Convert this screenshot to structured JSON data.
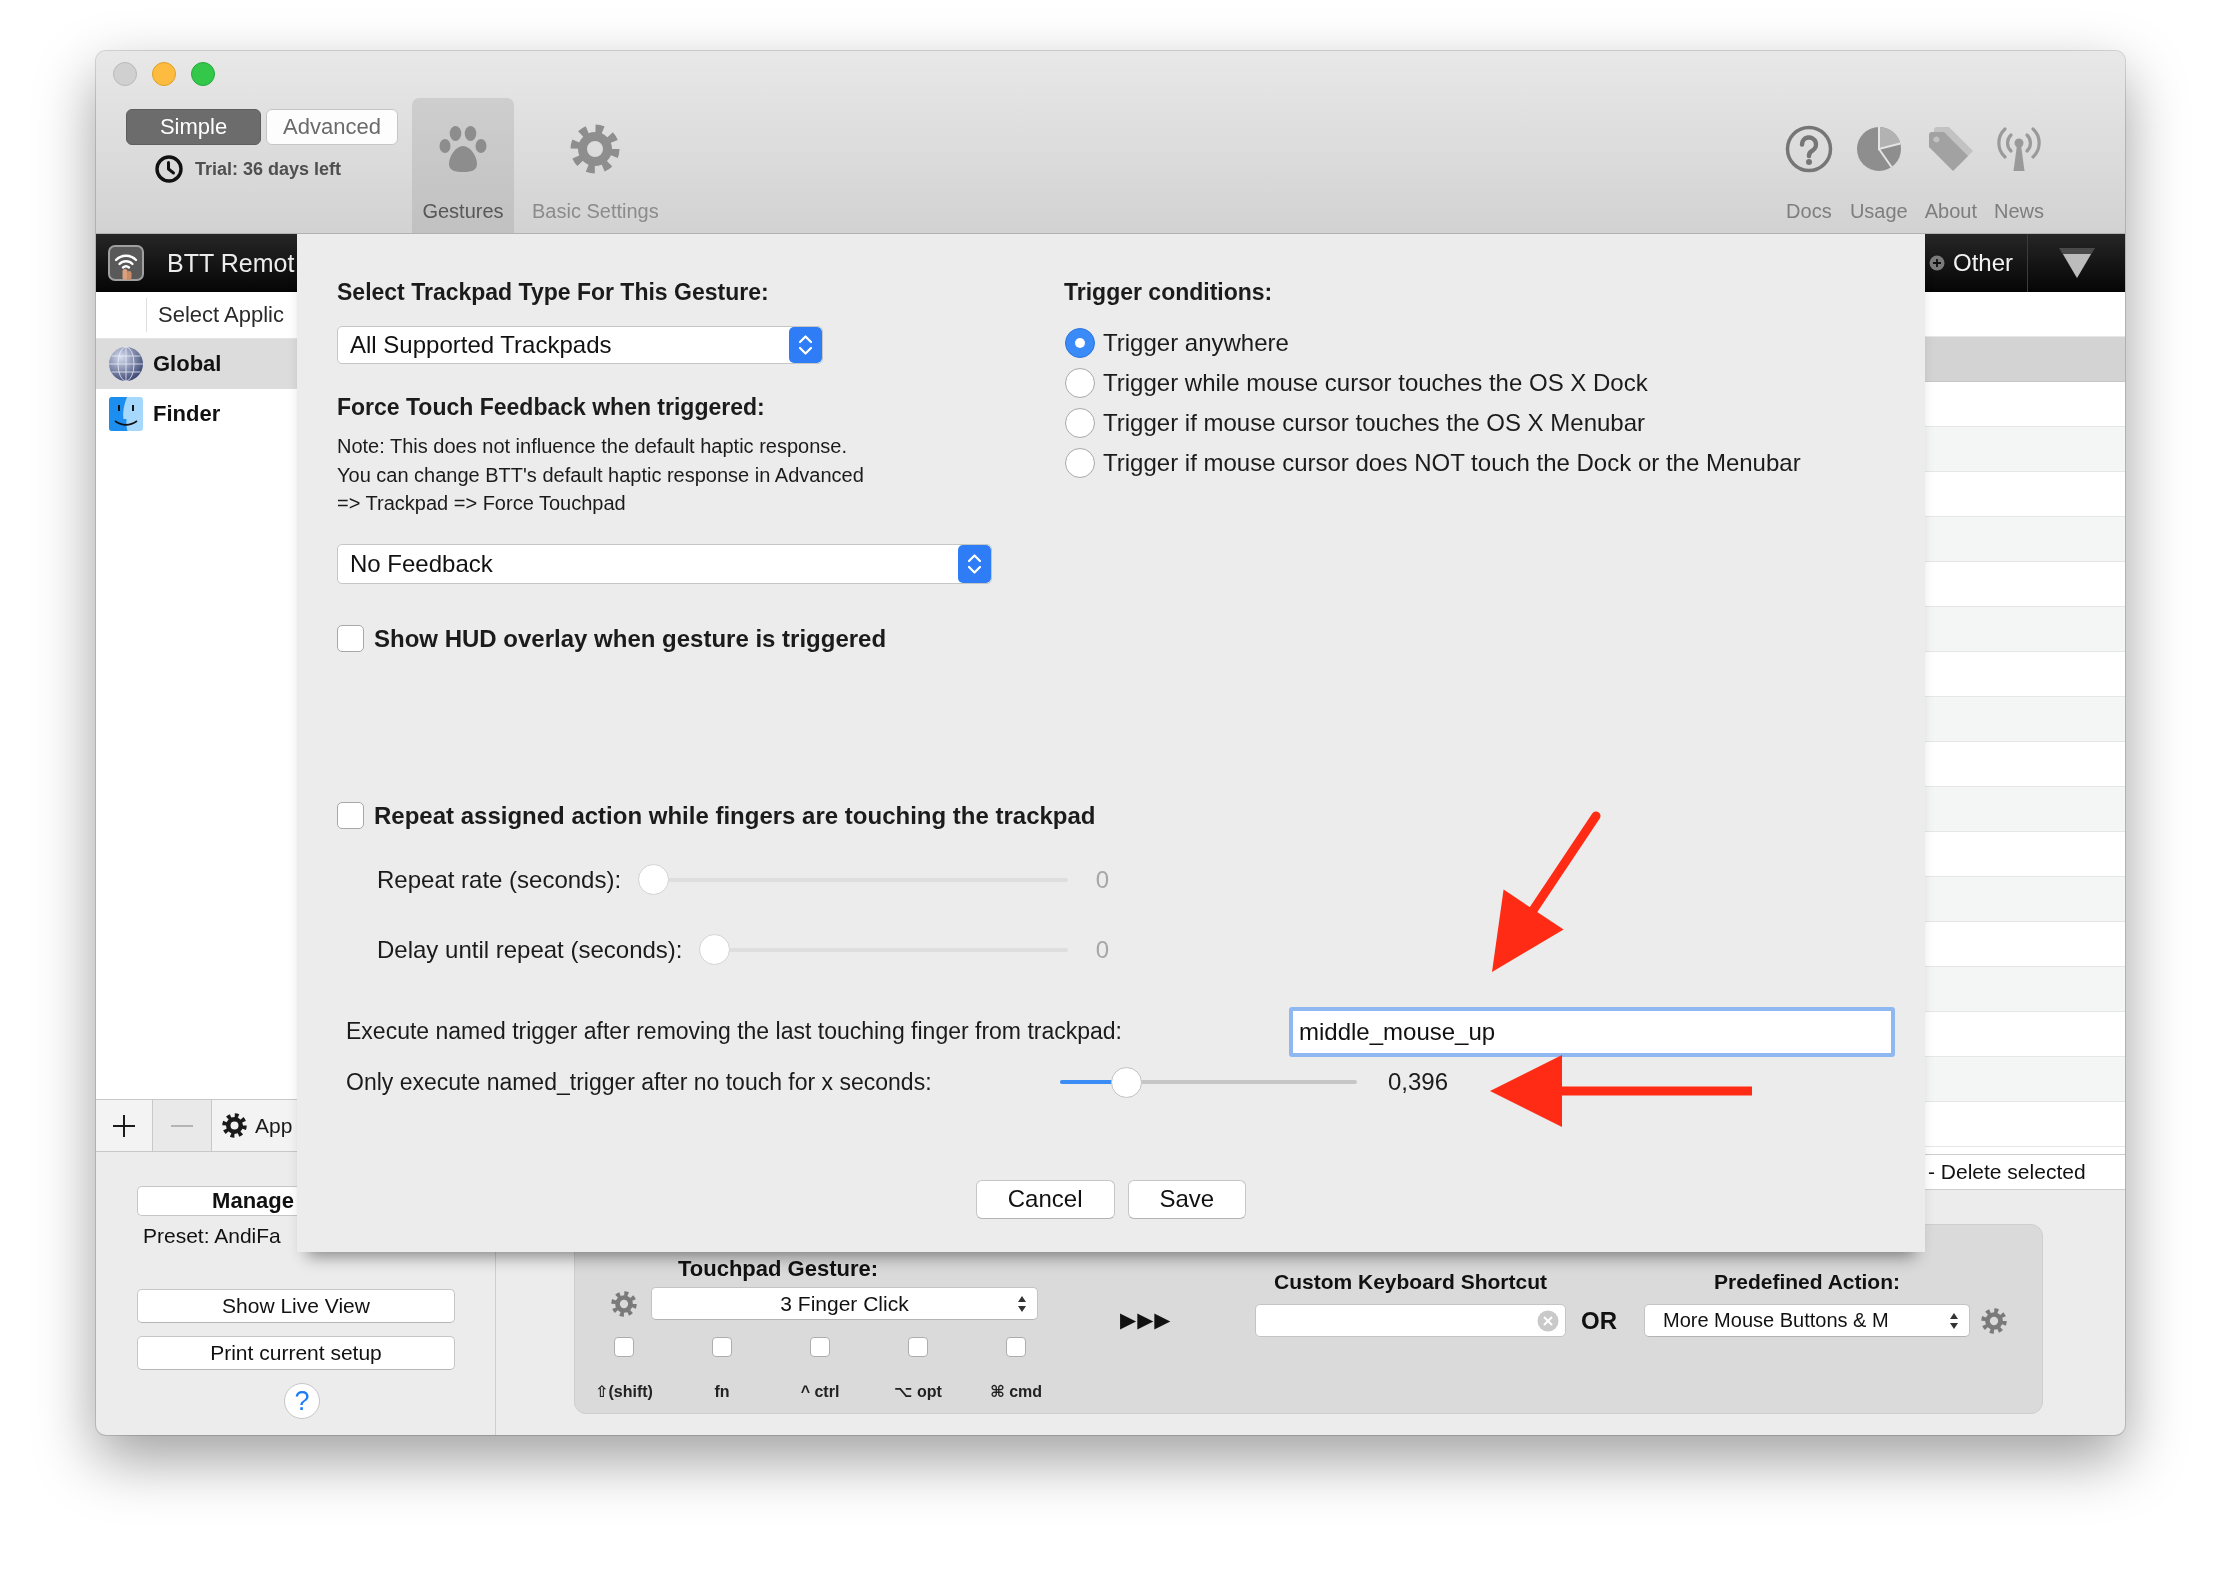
{
  "toolbar": {
    "modes": [
      {
        "label": "Simple",
        "selected": true
      },
      {
        "label": "Advanced",
        "selected": false
      }
    ],
    "trial": "Trial: 36 days left",
    "tabs": [
      {
        "label": "Gestures",
        "kind": "paw",
        "selected": true
      },
      {
        "label": "Basic Settings",
        "kind": "gear",
        "selected": false
      }
    ],
    "links": [
      {
        "label": "Docs",
        "kind": "help"
      },
      {
        "label": "Usage",
        "kind": "pie"
      },
      {
        "label": "About",
        "kind": "tag"
      },
      {
        "label": "News",
        "kind": "antenna"
      }
    ]
  },
  "sidebar": {
    "title": "BTT Remot",
    "column_header": "Select Applic",
    "apps": [
      {
        "name": "Global",
        "kind": "globe",
        "selected": true
      },
      {
        "name": "Finder",
        "kind": "finder",
        "selected": false
      }
    ],
    "list_buttons": [
      {
        "kind": "add",
        "disabled": false
      },
      {
        "kind": "remove",
        "disabled": true
      },
      {
        "kind": "settings",
        "label": "App",
        "disabled": false
      }
    ],
    "manage_button": "Manage",
    "preset": "Preset: AndiFa",
    "buttons": [
      "Show Live View",
      "Print current setup"
    ],
    "help_button": "?"
  },
  "gesture_list": {
    "filter": "Other",
    "rows": [
      {
        "selected": false
      },
      {
        "selected": true
      },
      {
        "selected": false
      },
      {
        "selected": false
      },
      {
        "selected": false
      },
      {
        "selected": false
      },
      {
        "selected": false
      },
      {
        "selected": false
      },
      {
        "selected": false
      },
      {
        "selected": false
      },
      {
        "selected": false
      },
      {
        "selected": false
      },
      {
        "selected": false
      },
      {
        "selected": false
      },
      {
        "selected": false
      },
      {
        "selected": false
      },
      {
        "selected": false
      },
      {
        "selected": false
      },
      {
        "selected": false
      }
    ],
    "delete_button": "- Delete selected"
  },
  "dialog": {
    "trackpad_type": {
      "label": "Select Trackpad Type For This Gesture:",
      "value": "All Supported Trackpads"
    },
    "force_touch": {
      "label": "Force Touch Feedback when triggered:",
      "note": "Note: This does not influence the default haptic response.\nYou can change BTT's default haptic response in Advanced\n=> Trackpad => Force Touchpad",
      "value": "No Feedback"
    },
    "show_hud": {
      "label": "Show HUD overlay when gesture is triggered",
      "checked": false
    },
    "trigger_conditions": {
      "label": "Trigger conditions:",
      "options": [
        {
          "label": "Trigger anywhere",
          "selected": true
        },
        {
          "label": "Trigger while mouse cursor touches the OS X Dock",
          "selected": false
        },
        {
          "label": "Trigger if mouse cursor touches the OS X Menubar",
          "selected": false
        },
        {
          "label": "Trigger if mouse cursor does NOT touch the Dock or the Menubar",
          "selected": false
        }
      ]
    },
    "repeat": {
      "label": "Repeat assigned action while fingers are touching the trackpad",
      "checked": false,
      "sliders": [
        {
          "label": "Repeat rate (seconds):",
          "level": 0,
          "reading": "0",
          "disabled": true
        },
        {
          "label": "Delay until repeat (seconds):",
          "level": 0,
          "reading": "0",
          "disabled": true
        }
      ]
    },
    "named_trigger": {
      "label": "Execute named trigger after removing the last touching finger from trackpad:",
      "value": "middle_mouse_up",
      "focused": true
    },
    "no_touch_delay": {
      "label": "Only execute named_trigger after no touch for x seconds:",
      "level": 0.19,
      "reading": "0,396",
      "disabled": false
    },
    "buttons": [
      {
        "label": "Cancel"
      },
      {
        "label": "Save"
      }
    ]
  },
  "gesture_config": {
    "title": "Touchpad Gesture:",
    "gesture": "3 Finger Click",
    "modifiers": [
      {
        "label": "⇧(shift)",
        "checked": false
      },
      {
        "label": "fn",
        "checked": false
      },
      {
        "label": "^ ctrl",
        "checked": false
      },
      {
        "label": "⌥ opt",
        "checked": false
      },
      {
        "label": "⌘ cmd",
        "checked": false
      }
    ],
    "arrows": "▶▶▶",
    "shortcut": {
      "label": "Custom Keyboard Shortcut"
    },
    "separator": "OR",
    "predefined": {
      "label": "Predefined Action:",
      "value": "More Mouse Buttons & M"
    }
  },
  "annotations": [
    {
      "kind": "arrow"
    },
    {
      "kind": "arrow"
    }
  ]
}
